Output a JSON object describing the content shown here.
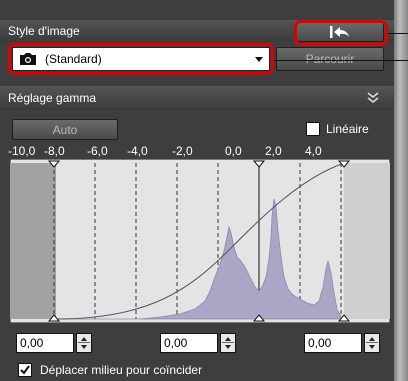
{
  "style": {
    "title": "Style d'image",
    "selected": "(Standard)",
    "browse_button": "Parcourir"
  },
  "gamma": {
    "title": "Réglage gamma",
    "auto_button": "Auto",
    "linear_label": "Linéaire",
    "linear_checked": false,
    "axis_ticks": [
      "-10,0",
      "-8,0",
      "-6,0",
      "-4,0",
      "-2,0",
      "0,0",
      "2,0",
      "4,0"
    ],
    "black_point": "0,00",
    "midpoint": "0,00",
    "white_point": "0,00",
    "move_midpoint_label": "Déplacer milieu pour coïncider",
    "move_midpoint_checked": true
  },
  "icons": [
    "camera-icon",
    "dropdown-arrow-icon",
    "reset-arrow-icon",
    "collapse-chevrons-icon",
    "checkbox-check-icon"
  ],
  "colors": {
    "panel": "#3e3e3e",
    "histogram": "#a9a6c6",
    "callout": "#e00000"
  }
}
